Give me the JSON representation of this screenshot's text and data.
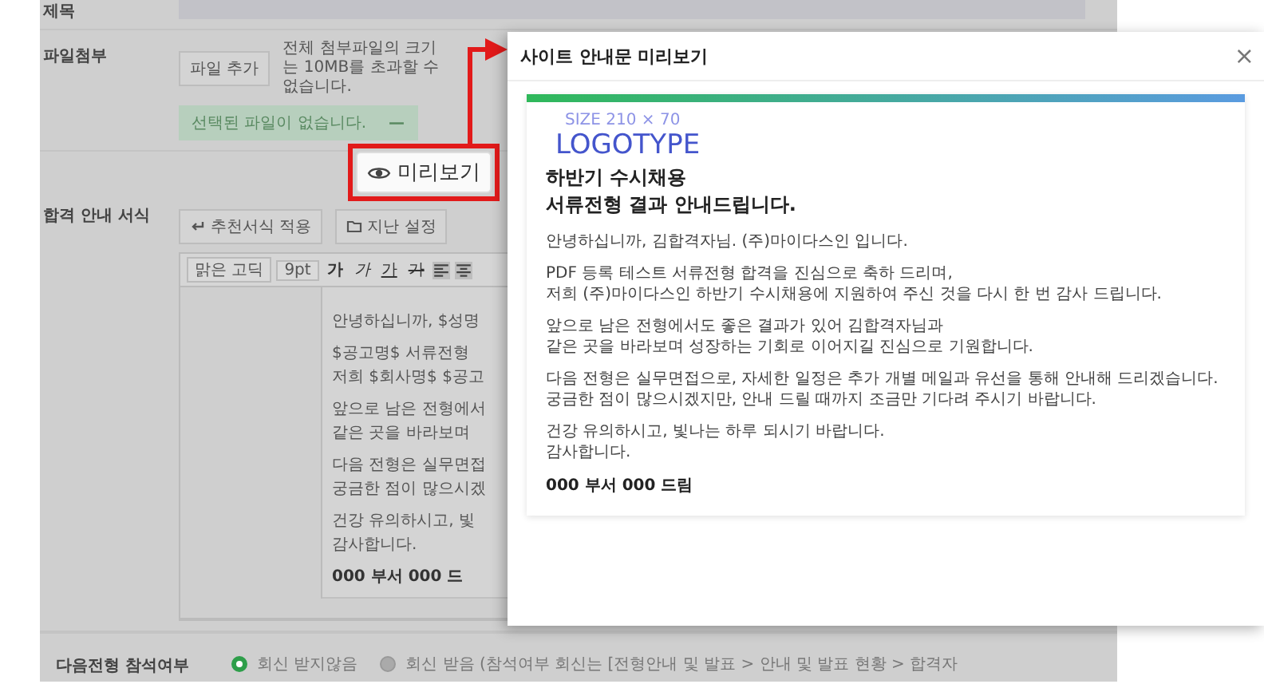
{
  "page": {
    "title_row": {
      "label": "제목"
    },
    "attachment": {
      "label": "파일첨부",
      "button": "파일 추가",
      "note": "전체 첨부파일의 크기는 10MB를 초과할 수 없습니다.",
      "empty_message": "선택된 파일이 없습니다.",
      "remove": "—"
    },
    "template": {
      "label": "합격 안내 서식",
      "buttons": [
        {
          "label": "추천서식 적용"
        },
        {
          "label": "지난 설정"
        }
      ],
      "toolbar": {
        "font": "맑은 고딕",
        "size": "9pt",
        "format_buttons": [
          {
            "kind": "bold",
            "label": "가"
          },
          {
            "kind": "italic",
            "label": "가"
          },
          {
            "kind": "underline",
            "label": "가"
          },
          {
            "kind": "strike",
            "label": "가"
          }
        ]
      },
      "content": [
        [
          "안녕하십니까, $성명"
        ],
        [
          "$공고명$ 서류전형",
          "저희 $회사명$ $공고"
        ],
        [
          "앞으로 남은 전형에서",
          "같은 곳을 바라보며"
        ],
        [
          "다음 전형은 실무면접",
          "궁금한 점이 많으시겠"
        ],
        [
          "건강 유의하시고, 빛",
          "감사합니다."
        ]
      ],
      "signature": "000 부서 000 드"
    },
    "attendance": {
      "label": "다음전형 참석여부",
      "options": [
        {
          "label": "회신 받지않음",
          "selected": true
        },
        {
          "label": "회신 받음 (참석여부 회신는 [전형안내 및 발표 > 안내 및 발표 현황 > 합격자",
          "selected": false
        }
      ]
    }
  },
  "callout": {
    "label": "미리보기"
  },
  "dialog": {
    "title": "사이트 안내문 미리보기",
    "close": "×",
    "logo_size": "SIZE 210 × 70",
    "logo": "LOGOTYPE",
    "heading": [
      "하반기 수시채용",
      "서류전형 결과 안내드립니다."
    ],
    "paragraphs": [
      [
        "안녕하십니까, 김합격자님. (주)마이다스인 입니다."
      ],
      [
        "PDF 등록 테스트 서류전형 합격을 진심으로 축하 드리며,",
        "저희 (주)마이다스인 하반기 수시채용에 지원하여 주신 것을 다시 한 번 감사 드립니다."
      ],
      [
        "앞으로 남은 전형에서도 좋은 결과가 있어 김합격자님과",
        "같은 곳을 바라보며 성장하는 기회로 이어지길 진심으로 기원합니다."
      ],
      [
        "다음 전형은 실무면접으로, 자세한 일정은 추가 개별 메일과 유선을 통해 안내해 드리겠습니다.",
        "궁금한 점이 많으시겠지만, 안내 드릴 때까지 조금만 기다려 주시기 바랍니다."
      ],
      [
        "건강 유의하시고, 빛나는 하루 되시기 바랍니다.",
        "감사합니다."
      ]
    ],
    "signature": "000 부서 000 드림"
  }
}
